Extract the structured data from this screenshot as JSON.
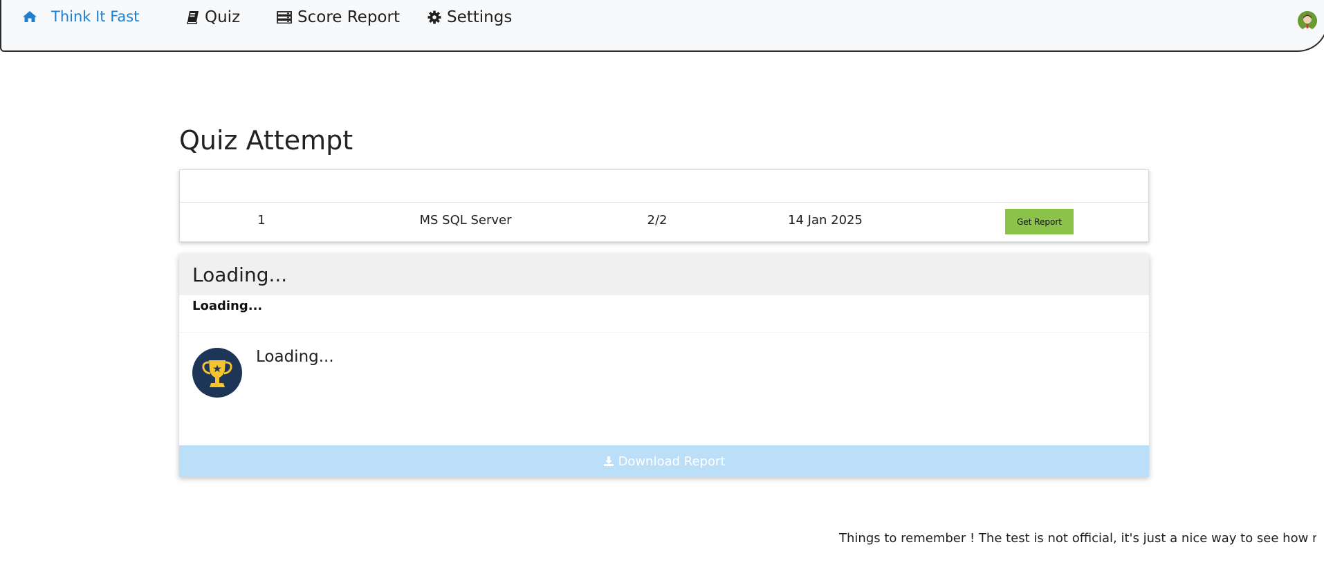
{
  "navbar": {
    "brand": {
      "label": "Think It Fast",
      "icon": "home-icon"
    },
    "links": [
      {
        "label": "Quiz",
        "icon": "book-icon"
      },
      {
        "label": "Score Report",
        "icon": "server-icon"
      },
      {
        "label": "Settings",
        "icon": "gear-icon"
      }
    ],
    "avatar_icon": "user-avatar-icon",
    "brand_color": "#1f7fcf"
  },
  "page": {
    "title": "Quiz Attempt"
  },
  "attempts": {
    "rows": [
      {
        "number": "1",
        "topic": "MS SQL Server",
        "score": "2/2",
        "date": "14 Jan 2025",
        "action_label": "Get Report"
      }
    ],
    "action_color": "#8bc34a"
  },
  "report": {
    "header": "Loading...",
    "subtitle": "Loading...",
    "body_text": "Loading...",
    "trophy_icon": "trophy-icon",
    "download_label": "Download Report",
    "download_icon": "download-icon",
    "download_color": "#bbdef9"
  },
  "footer": {
    "note": "Things to remember ! The test is not official, it's just a nice way to see how much y"
  }
}
